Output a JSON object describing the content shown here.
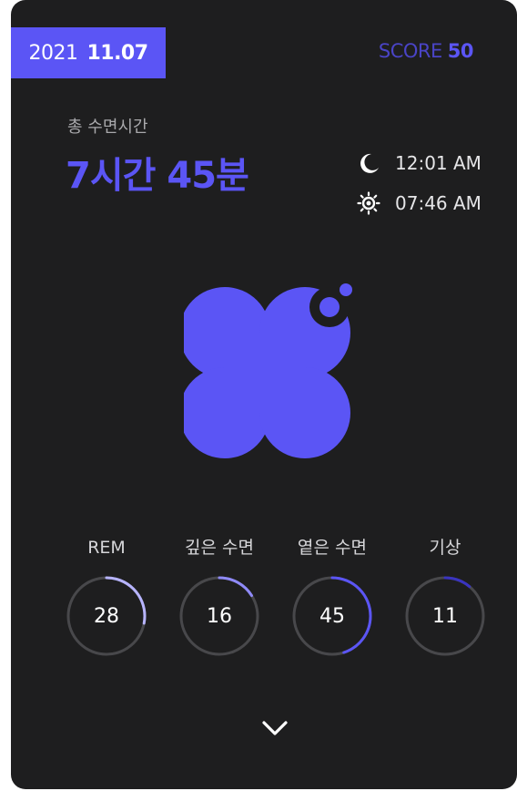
{
  "header": {
    "year": "2021",
    "month_day": "11.07",
    "score_label": "SCORE",
    "score_value": "50"
  },
  "summary": {
    "total_label": "총 수면시간",
    "total_value": "7시간 45분",
    "bed_time": "12:01 AM",
    "wake_time": "07:46 AM",
    "bed_icon": "moon-icon",
    "wake_icon": "sun-icon"
  },
  "colors": {
    "accent": "#5b55f5",
    "rem": "#b7b4ff",
    "deep": "#8f8af8",
    "light": "#5b55f5",
    "awake": "#3a34c0",
    "track": "#48484b",
    "card": "#1e1e1f"
  },
  "stats": [
    {
      "label": "REM",
      "value": "28",
      "percent": 28
    },
    {
      "label": "깊은 수면",
      "value": "16",
      "percent": 16
    },
    {
      "label": "옅은 수면",
      "value": "45",
      "percent": 45
    },
    {
      "label": "기상",
      "value": "11",
      "percent": 11
    }
  ],
  "footer": {
    "expand_icon": "chevron-down-icon"
  }
}
